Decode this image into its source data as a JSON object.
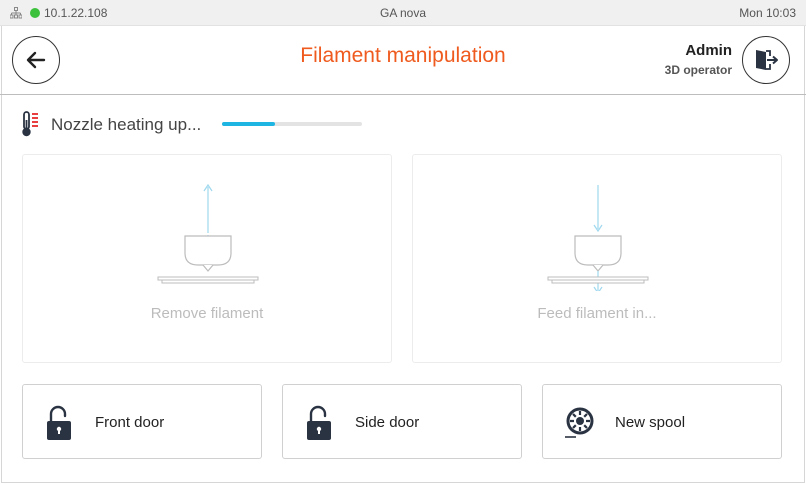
{
  "status_bar": {
    "ip": "10.1.22.108",
    "device": "GA nova",
    "clock": "Mon 10:03",
    "online_color": "#3cc13c",
    "network_icon": "network-icon"
  },
  "header": {
    "title": "Filament manipulation",
    "user_name": "Admin",
    "user_role": "3D operator",
    "back_icon": "arrow-left-icon",
    "logout_icon": "logout-icon",
    "title_color": "#ef5a1e"
  },
  "heating": {
    "label": "Nozzle heating up...",
    "icon": "thermometer-icon",
    "progress": 0.38,
    "progress_color": "#1fb5e2"
  },
  "actions": [
    {
      "label": "Remove filament",
      "icon": "nozzle-remove-icon",
      "enabled": false
    },
    {
      "label": "Feed filament in...",
      "icon": "nozzle-feed-icon",
      "enabled": false
    }
  ],
  "tiles": [
    {
      "label": "Front door",
      "icon": "unlocked-padlock-icon"
    },
    {
      "label": "Side door",
      "icon": "unlocked-padlock-icon"
    },
    {
      "label": "New spool",
      "icon": "spool-icon"
    }
  ]
}
